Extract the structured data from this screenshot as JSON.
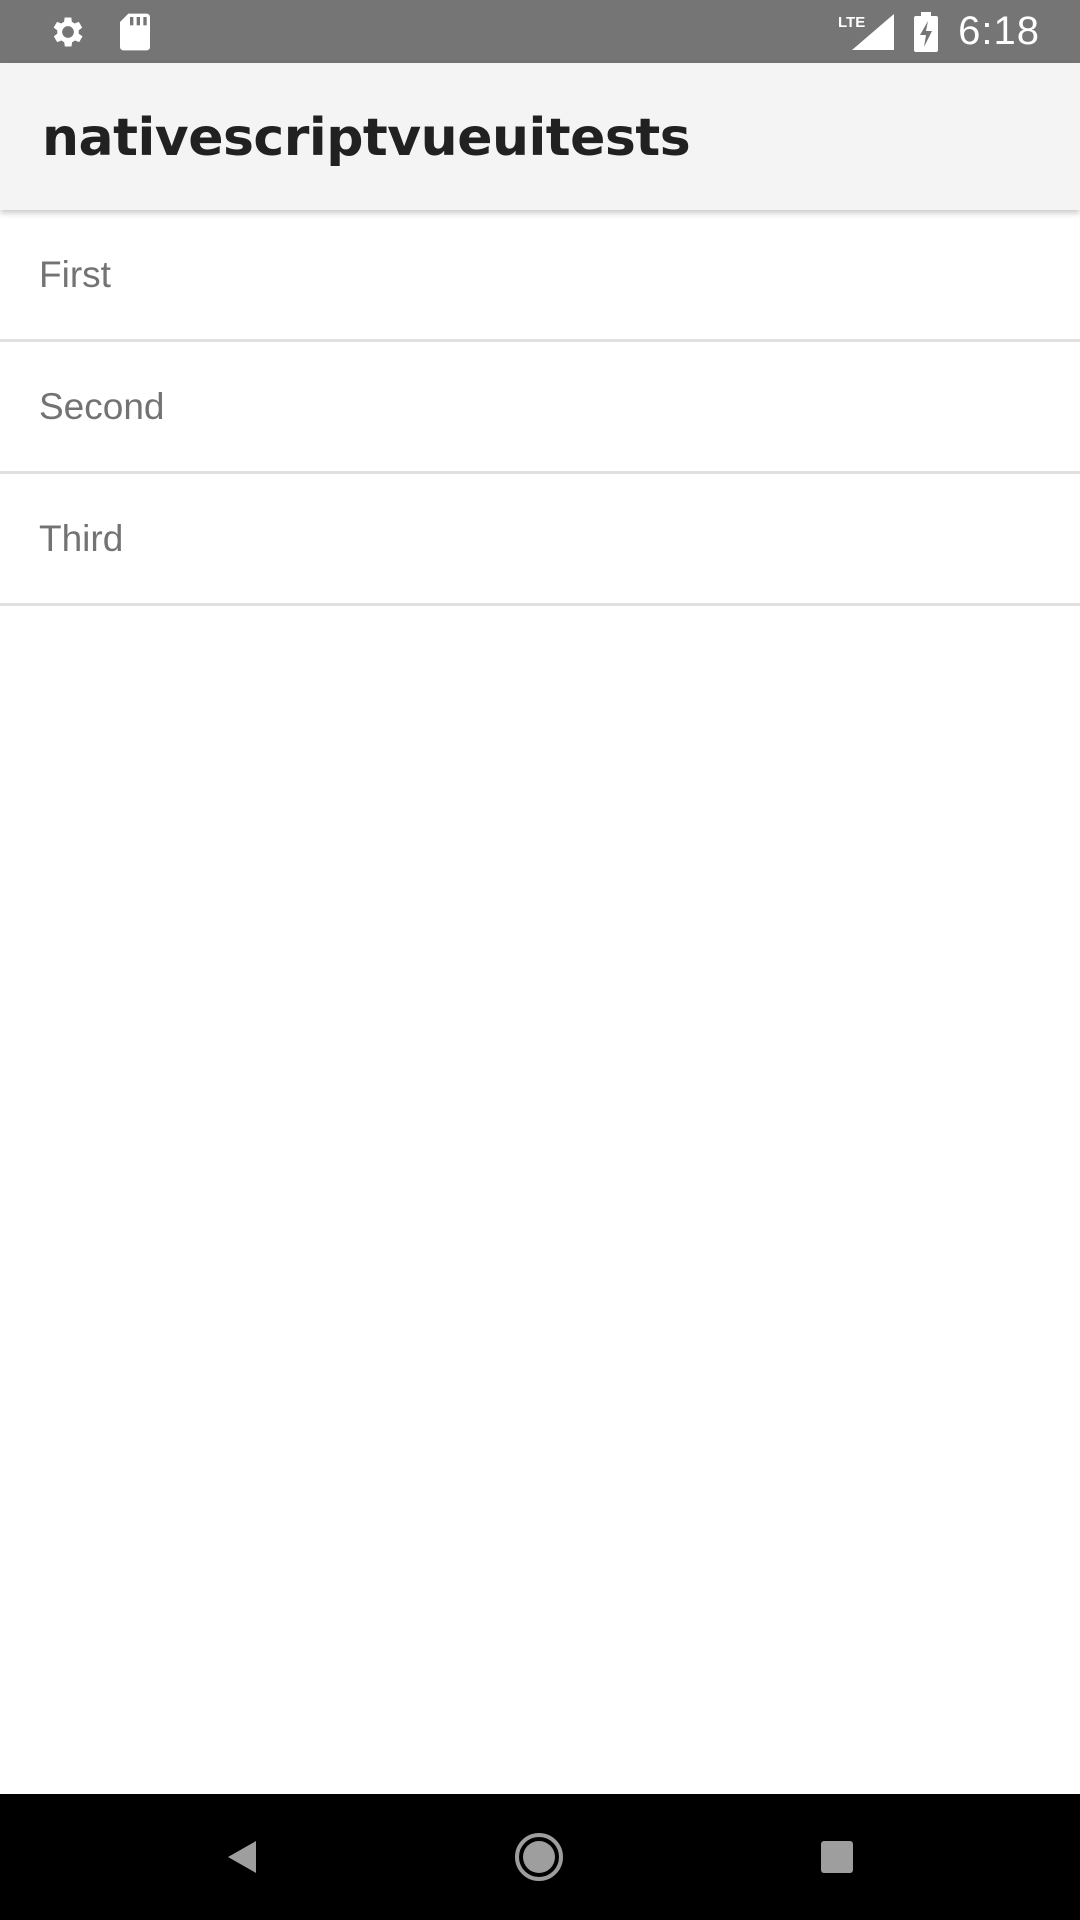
{
  "status_bar": {
    "time": "6:18",
    "network_label": "LTE",
    "icons": [
      "settings-gear-icon",
      "sd-card-icon",
      "lte-signal-icon",
      "battery-charging-icon"
    ]
  },
  "app_bar": {
    "title": "nativescriptvueuitests"
  },
  "list": {
    "items": [
      {
        "label": "First"
      },
      {
        "label": "Second"
      },
      {
        "label": "Third"
      }
    ]
  },
  "nav_bar": {
    "buttons": [
      "back-icon",
      "home-icon",
      "recent-apps-icon"
    ]
  },
  "colors": {
    "status_bar_bg": "#757575",
    "app_bar_bg": "#f4f4f4",
    "list_text": "#737373",
    "divider": "#e0e0e0",
    "nav_bar_bg": "#000000"
  }
}
